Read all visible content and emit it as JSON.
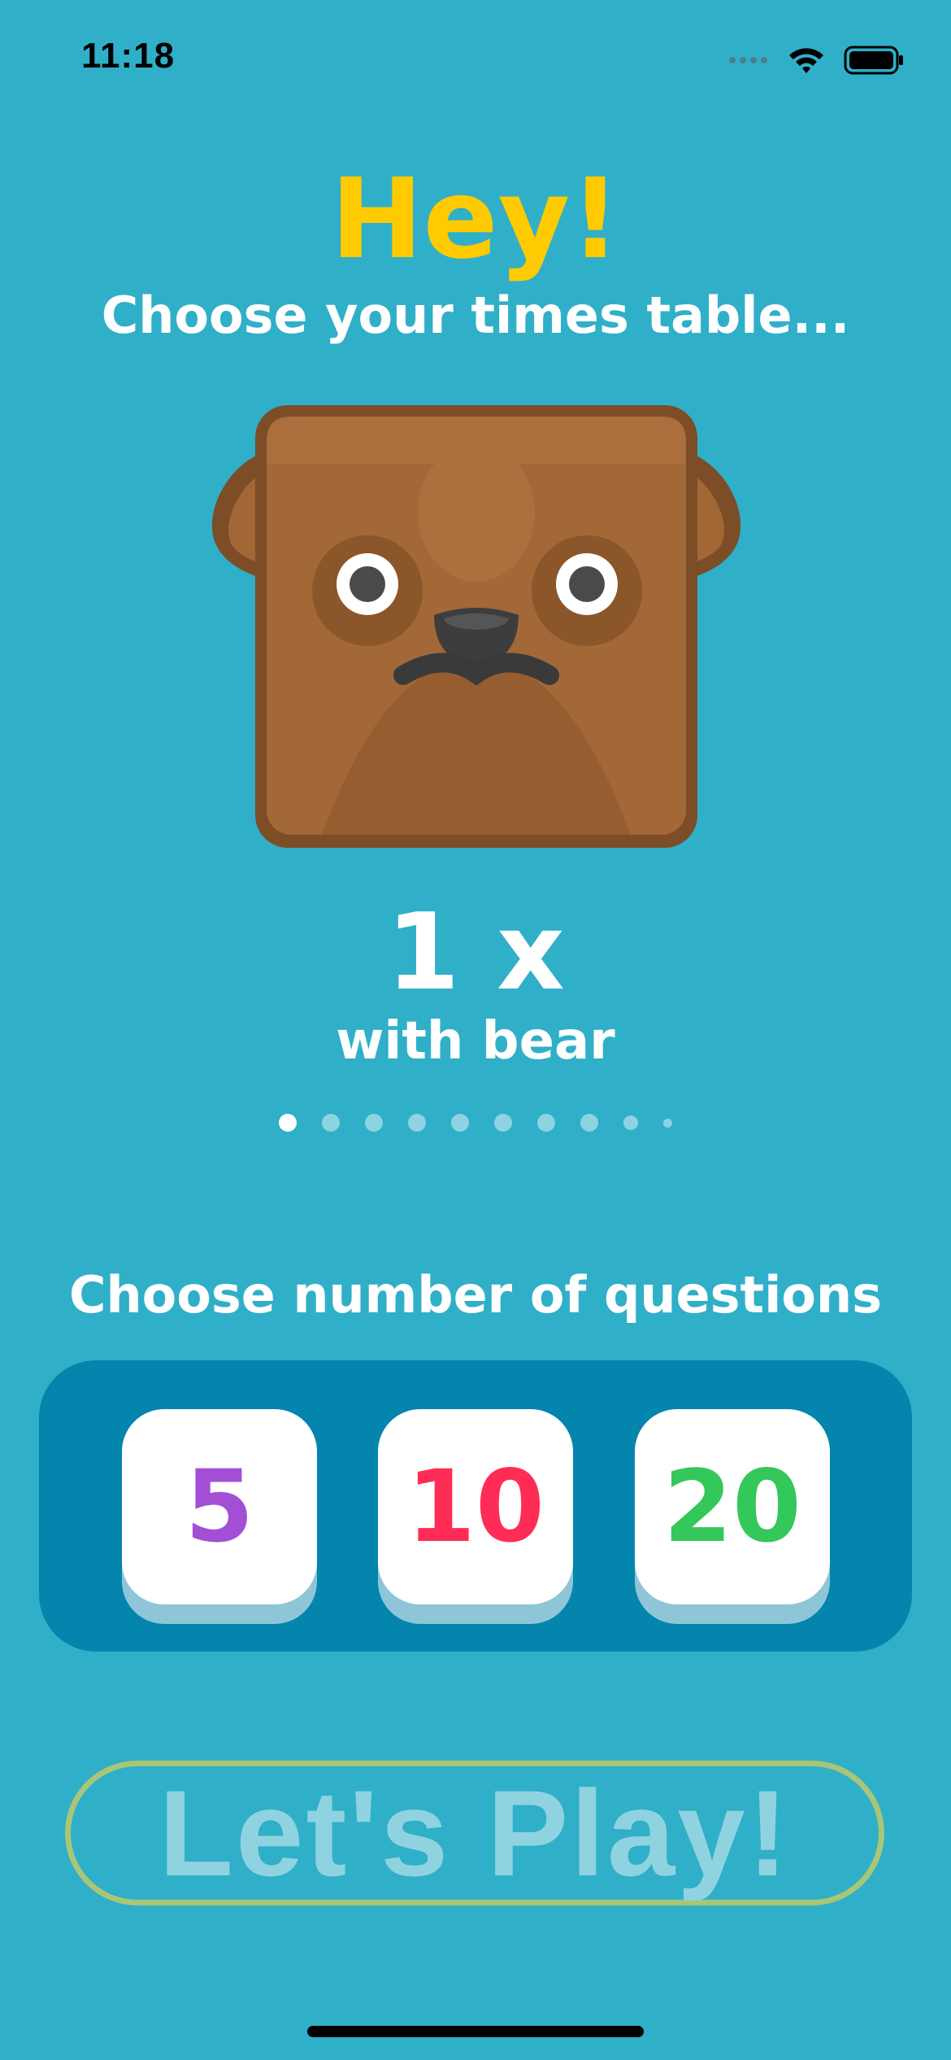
{
  "status_bar": {
    "time": "11:18",
    "icons": [
      "cellular-signal-icon",
      "wifi-icon",
      "battery-icon"
    ]
  },
  "header": {
    "title": "Hey!",
    "subtitle": "Choose your times table..."
  },
  "selector": {
    "table_number": "1 x",
    "animal_caption": "with bear",
    "mascot_icon": "bear-icon",
    "page_count": 10,
    "current_page": 1
  },
  "questions": {
    "label": "Choose number of questions",
    "options": [
      {
        "label": "5",
        "color": "#a24fd6"
      },
      {
        "label": "10",
        "color": "#ff2d55"
      },
      {
        "label": "20",
        "color": "#34c759"
      }
    ]
  },
  "play_button": {
    "label": "Let's Play!"
  },
  "colors": {
    "background": "#30afc8",
    "title": "#ffcb00",
    "panel": "#0385ad",
    "play_border": "#a9c676",
    "play_text": "#8fd3e0"
  }
}
